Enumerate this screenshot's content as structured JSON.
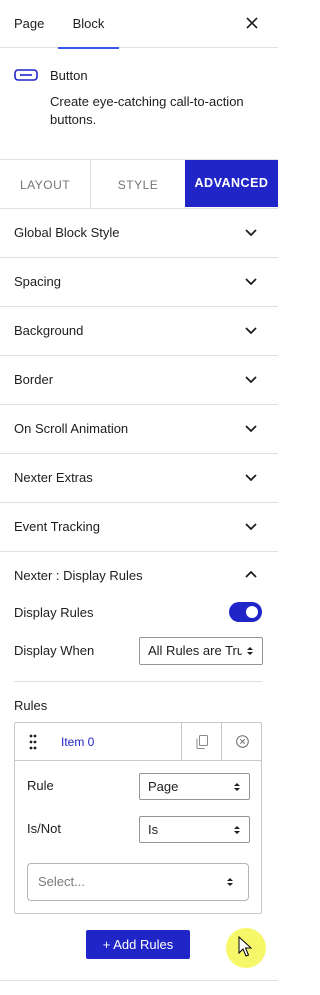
{
  "top_tabs": {
    "page": "Page",
    "block": "Block"
  },
  "block": {
    "name": "Button",
    "description": "Create eye-catching call-to-action buttons."
  },
  "settings_tabs": {
    "layout": "LAYOUT",
    "style": "STYLE",
    "advanced": "ADVANCED",
    "active": "advanced"
  },
  "accordions": [
    "Global Block Style",
    "Spacing",
    "Background",
    "Border",
    "On Scroll Animation",
    "Nexter Extras",
    "Event Tracking"
  ],
  "display_rules": {
    "title": "Nexter : Display Rules",
    "display_rules_label": "Display Rules",
    "display_rules_enabled": true,
    "display_when_label": "Display When",
    "display_when_value": "All Rules are True",
    "rules_label": "Rules",
    "item": {
      "title": "Item 0",
      "rule_label": "Rule",
      "rule_value": "Page",
      "isnot_label": "Is/Not",
      "isnot_value": "Is",
      "select_placeholder": "Select..."
    },
    "add_button": "+ Add Rules"
  },
  "colors": {
    "accent": "#2025c8",
    "tab_underline": "#3858e9"
  }
}
